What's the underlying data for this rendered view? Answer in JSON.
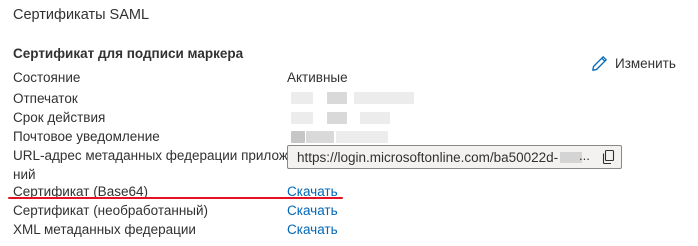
{
  "section_title": "Сертификаты SAML",
  "subsection_title": "Сертификат для подписи маркера",
  "edit_label": "Изменить",
  "rows": [
    {
      "label": "Состояние",
      "value": "Активные"
    },
    {
      "label": "Отпечаток",
      "value": ""
    },
    {
      "label": "Срок действия",
      "value": ""
    },
    {
      "label": "Почтовое уведомление",
      "value": ""
    },
    {
      "label_line1": "URL-адрес метаданных федерации приложе",
      "label_line2": "ний",
      "value": "https://login.microsoftonline.com/ba50022d-",
      "value_ellipsis": "..."
    },
    {
      "label": "Сертификат (Base64)",
      "value": "Скачать"
    },
    {
      "label": "Сертификат (необработанный)",
      "value": "Скачать"
    },
    {
      "label": "XML метаданных федерации",
      "value": "Скачать"
    }
  ],
  "icons": {
    "edit": "pencil-icon",
    "copy": "copy-icon"
  },
  "colors": {
    "link": "#0067b8",
    "highlight_underline": "#e81123",
    "text": "#323130"
  }
}
